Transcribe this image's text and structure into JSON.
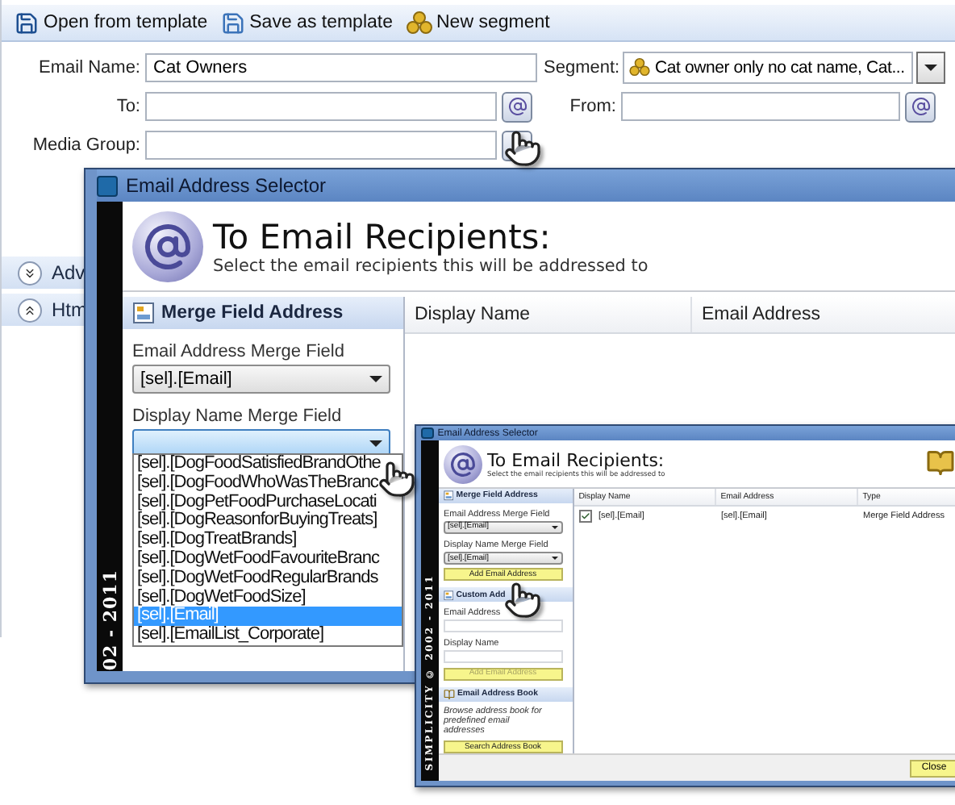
{
  "toolbar": {
    "buttons": [
      {
        "label": "Open from template",
        "kind": "open"
      },
      {
        "label": "Save as template",
        "kind": "save"
      },
      {
        "label": "New segment",
        "kind": "segment"
      }
    ]
  },
  "form": {
    "email_name": {
      "label": "Email Name:",
      "value": "Cat Owners"
    },
    "segment": {
      "label": "Segment:",
      "value": "Cat owner only no cat name, Cat..."
    },
    "to": {
      "label": "To:"
    },
    "from": {
      "label": "From:"
    },
    "media_group": {
      "label": "Media Group:"
    }
  },
  "side_panels": [
    {
      "label": "Adv",
      "expanded": false
    },
    {
      "label": "Htm",
      "expanded": true
    }
  ],
  "dialog": {
    "title": "Email Address Selector",
    "heading": "To Email Recipients:",
    "subtitle": "Select the email recipients this will be addressed to",
    "stripe_text": "02 - 2011",
    "merge_panel": {
      "title": "Merge Field Address",
      "email_label": "Email Address Merge Field",
      "email_value": "[sel].[Email]",
      "display_label": "Display Name Merge Field"
    },
    "dropdown": {
      "items": [
        {
          "label": "[sel].[DogFoodSatisfiedBrandOthe",
          "selected": false
        },
        {
          "label": "[sel].[DogFoodWhoWasTheBranc",
          "selected": false
        },
        {
          "label": "[sel].[DogPetFoodPurchaseLocati",
          "selected": false
        },
        {
          "label": "[sel].[DogReasonforBuyingTreats]",
          "selected": false
        },
        {
          "label": "[sel].[DogTreatBrands]",
          "selected": false
        },
        {
          "label": "[sel].[DogWetFoodFavouriteBranc",
          "selected": false
        },
        {
          "label": "[sel].[DogWetFoodRegularBrands",
          "selected": false
        },
        {
          "label": "[sel].[DogWetFoodSize]",
          "selected": false
        },
        {
          "label": "[sel].[Email]",
          "selected": true
        },
        {
          "label": "[sel].[EmailList_Corporate]",
          "selected": false
        }
      ]
    },
    "list": {
      "columns": [
        "Display Name",
        "Email Address"
      ]
    }
  },
  "inset_dialog": {
    "title": "Email Address Selector",
    "heading": "To Email Recipients:",
    "subtitle": "Select the email recipients this will be addressed to",
    "stripe_text": "SIMPLICITY © 2002 - 2011",
    "merge_panel": {
      "title": "Merge Field Address",
      "email_label": "Email Address Merge Field",
      "email_value": "[sel].[Email]",
      "display_label": "Display Name Merge Field",
      "display_value": "[sel].[Email]",
      "button": {
        "label": "Add Email Address",
        "disabled": false
      }
    },
    "custom_panel": {
      "title": "Custom Add",
      "email_label": "Email Address",
      "display_label": "Display Name",
      "button": {
        "label": "Add Email Address",
        "disabled": true
      }
    },
    "book_panel": {
      "title": "Email Address Book",
      "text": "Browse address book for predefined email addresses",
      "button": {
        "label": "Search Address Book",
        "disabled": false
      }
    },
    "list": {
      "columns": [
        "Display Name",
        "Email Address",
        "Type"
      ],
      "rows": [
        {
          "checked": true,
          "cells": [
            "[sel].[Email]",
            "[sel].[Email]",
            "Merge Field Address"
          ]
        }
      ]
    },
    "close_button": "Close"
  }
}
